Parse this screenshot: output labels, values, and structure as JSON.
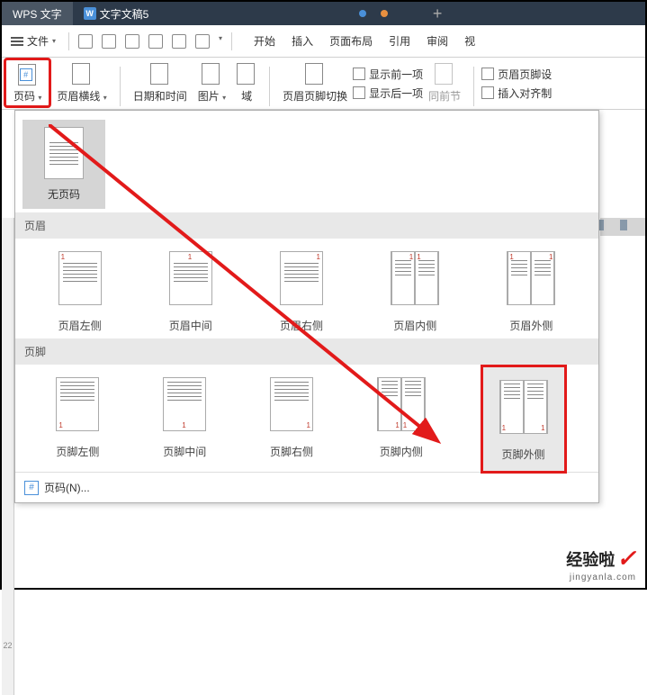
{
  "titlebar": {
    "app_tab": "WPS 文字",
    "doc_tab": "文字文稿5",
    "plus": "+"
  },
  "mainbar": {
    "file_label": "文件",
    "menu_tabs": [
      "开始",
      "插入",
      "页面布局",
      "引用",
      "审阅",
      "视"
    ]
  },
  "ribbon": {
    "page_number": "页码",
    "header_line": "页眉横线",
    "datetime": "日期和时间",
    "image": "图片",
    "field": "域",
    "header_footer_switch": "页眉页脚切换",
    "show_prev": "显示前一项",
    "show_next": "显示后一项",
    "same_section": "同前节",
    "header_footer_settings": "页眉页脚设",
    "insert_align": "插入对齐制"
  },
  "dropdown": {
    "no_page_number": "无页码",
    "section_header": "页眉",
    "section_footer": "页脚",
    "header_options": [
      {
        "label": "页眉左侧"
      },
      {
        "label": "页眉中间"
      },
      {
        "label": "页眉右侧"
      },
      {
        "label": "页眉内侧"
      },
      {
        "label": "页眉外侧"
      }
    ],
    "footer_options": [
      {
        "label": "页脚左侧"
      },
      {
        "label": "页脚中间"
      },
      {
        "label": "页脚右侧"
      },
      {
        "label": "页脚内侧"
      },
      {
        "label": "页脚外侧"
      }
    ],
    "footer_action": "页码(N)..."
  },
  "watermark": {
    "main": "经验啦",
    "sub": "jingyanla.com"
  },
  "ruler": {
    "num": "22"
  },
  "icons": {
    "hash": "#"
  }
}
